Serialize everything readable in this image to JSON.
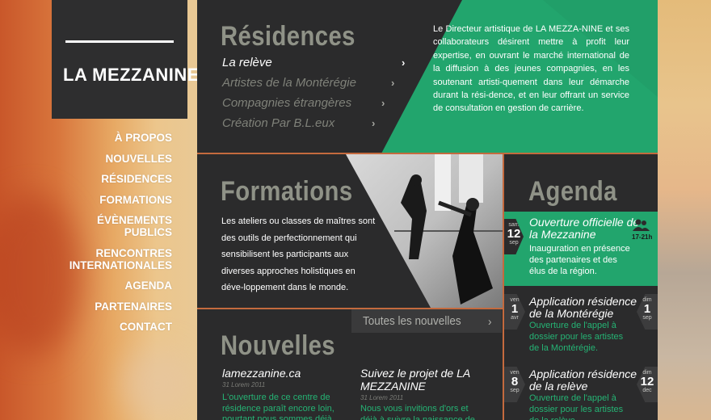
{
  "site": {
    "logo_text": "LA MEZZANINE"
  },
  "nav": {
    "items": [
      {
        "label": "À PROPOS",
        "line2": ""
      },
      {
        "label": "NOUVELLES",
        "line2": ""
      },
      {
        "label": "RÉSIDENCES",
        "line2": ""
      },
      {
        "label": "FORMATIONS",
        "line2": ""
      },
      {
        "label": "ÉVÈNEMENTS PUBLICS",
        "line2": ""
      },
      {
        "label": "RENCONTRES",
        "line2": "INTERNATIONALES"
      },
      {
        "label": "AGENDA",
        "line2": ""
      },
      {
        "label": "PARTENAIRES",
        "line2": ""
      },
      {
        "label": "CONTACT",
        "line2": ""
      }
    ]
  },
  "residences": {
    "title": "Résidences",
    "items": [
      "La relève",
      "Artistes de la Montérégie",
      "Compagnies étrangères",
      "Création Par B.L.eux"
    ],
    "chevron": "›",
    "text": "Le Directeur artistique de LA MEZZA-NINE et ses collaborateurs désirent mettre à profit leur expertise, en ouvrant le marché international de la diffusion à des jeunes compagnies, en les soutenant artisti-quement dans leur démarche durant la rési-dence, et en leur offrant un service de consultation en gestion de carrière."
  },
  "formations": {
    "title": "Formations",
    "text": "Les ateliers ou classes de maîtres sont des outils de perfectionnement qui sensibilisent les participants aux diverses approches holistiques en déve-loppement dans le monde."
  },
  "nouvelles": {
    "title": "Nouvelles",
    "all_link": "Toutes les nouvelles",
    "items": [
      {
        "title": "lamezzanine.ca",
        "date": "31 Lorem 2011",
        "body": "L'ouverture de ce centre de résidence paraît encore loin, pourtant nous sommes déjà en"
      },
      {
        "title": "Suivez le projet de LA MEZZANINE",
        "date": "31 Lorem 2011",
        "body": "Nous vous invitions d'ors et déjà à suivre la naissance de"
      }
    ]
  },
  "agenda": {
    "title": "Agenda",
    "items": [
      {
        "day": "sam",
        "num": "12",
        "month": "sep",
        "title1": "Ouverture officielle de",
        "title2": "la Mezzanine",
        "desc": "Inauguration en présence des partenaires et des élus de la région.",
        "right_label": "17-21h"
      },
      {
        "day": "ven",
        "num": "1",
        "month": "avr",
        "title1": "Application résidence",
        "title2": "de la Montérégie",
        "desc": "Ouverture de l'appel à dossier pour les artistes de la Montérégie.",
        "r_day": "dim",
        "r_num": "1",
        "r_month": "sep"
      },
      {
        "day": "ven",
        "num": "8",
        "month": "sep",
        "title1": "Application résidence",
        "title2": "de la relève",
        "desc": "Ouverture de l'appel à dossier pour les artistes de la relève",
        "r_day": "dim",
        "r_num": "12",
        "r_month": "dec"
      }
    ]
  },
  "colors": {
    "accent": "#22a56d",
    "panel": "#2b2b2c",
    "divider": "#c46a3e"
  }
}
